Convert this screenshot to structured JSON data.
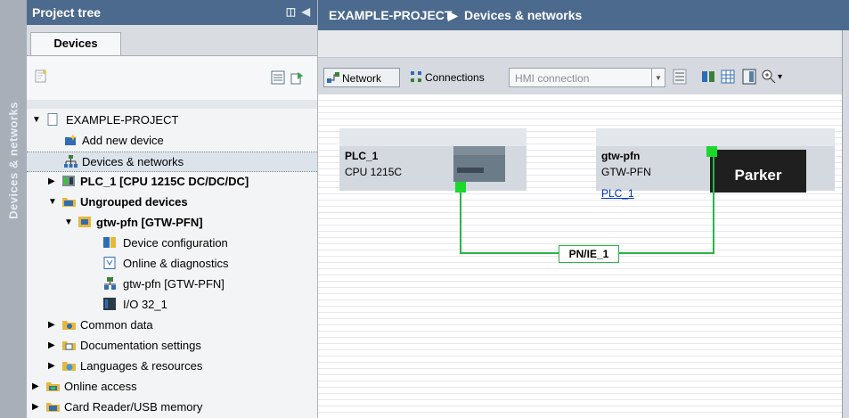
{
  "side_tab": {
    "label": "Devices & networks"
  },
  "project_tree": {
    "title": "Project tree",
    "tab": "Devices",
    "items": [
      {
        "label": "EXAMPLE-PROJECT",
        "icon": "project-icon",
        "expanded": true
      },
      {
        "label": "Add new device",
        "icon": "add-device-icon"
      },
      {
        "label": "Devices & networks",
        "icon": "network-icon"
      },
      {
        "label": "PLC_1 [CPU 1215C DC/DC/DC]",
        "icon": "plc-icon",
        "expanded": false
      },
      {
        "label": "Ungrouped devices",
        "icon": "folder-icon",
        "expanded": true
      },
      {
        "label": "gtw-pfn [GTW-PFN]",
        "icon": "device-icon",
        "expanded": true
      },
      {
        "label": "Device configuration",
        "icon": "device-config-icon"
      },
      {
        "label": "Online & diagnostics",
        "icon": "diagnostics-icon"
      },
      {
        "label": "gtw-pfn [GTW-PFN]",
        "icon": "io-device-icon"
      },
      {
        "label": "I/O 32_1",
        "icon": "io-module-icon"
      },
      {
        "label": "Common data",
        "icon": "common-data-icon",
        "expanded": false
      },
      {
        "label": "Documentation settings",
        "icon": "documentation-icon",
        "expanded": false
      },
      {
        "label": "Languages & resources",
        "icon": "languages-icon",
        "expanded": false
      },
      {
        "label": "Online access",
        "icon": "online-access-icon",
        "expanded": false
      },
      {
        "label": "Card Reader/USB memory",
        "icon": "card-reader-icon",
        "expanded": false
      }
    ]
  },
  "editor": {
    "breadcrumb": [
      "EXAMPLE-PROJECT",
      "Devices & networks"
    ],
    "toolbar": {
      "network": "Network",
      "connections": "Connections",
      "hmi_connection": "HMI connection"
    },
    "devices": [
      {
        "name": "PLC_1",
        "type": "CPU 1215C"
      },
      {
        "name": "gtw-pfn",
        "type": "GTW-PFN",
        "link": "PLC_1",
        "brand": "Parker"
      }
    ],
    "subnet": "PN/IE_1",
    "colors": {
      "header": "#4c6a8d",
      "link": "#2db34a",
      "device_box": "#d7dce3"
    }
  }
}
